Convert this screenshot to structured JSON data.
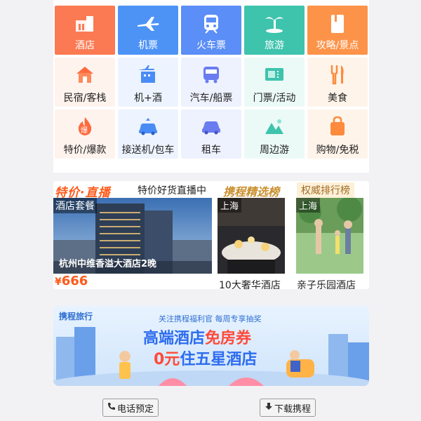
{
  "grid": {
    "row1": [
      {
        "label": "酒店",
        "icon": "hotel-building-icon"
      },
      {
        "label": "机票",
        "icon": "airplane-icon"
      },
      {
        "label": "火车票",
        "icon": "train-icon"
      },
      {
        "label": "旅游",
        "icon": "palm-tree-icon"
      },
      {
        "label": "攻略/景点",
        "icon": "guidebook-icon"
      }
    ],
    "row2": [
      {
        "label": "民宿/客栈",
        "icon": "house-icon"
      },
      {
        "label": "机+酒",
        "icon": "plane-hotel-icon"
      },
      {
        "label": "汽车/船票",
        "icon": "bus-icon"
      },
      {
        "label": "门票/活动",
        "icon": "ticket-icon"
      },
      {
        "label": "美食",
        "icon": "fork-knife-icon"
      }
    ],
    "row3": [
      {
        "label": "特价/爆款",
        "icon": "hot-deal-icon"
      },
      {
        "label": "接送机/包车",
        "icon": "car-pickup-icon"
      },
      {
        "label": "租车",
        "icon": "car-rental-icon"
      },
      {
        "label": "周边游",
        "icon": "mountain-icon"
      },
      {
        "label": "购物/免税",
        "icon": "shopping-bag-icon"
      }
    ]
  },
  "live": {
    "title": "特价·直播",
    "subtitle": "特价好货直播中",
    "tag": "酒店套餐",
    "caption": "杭州中维香溢大酒店2晚",
    "currency": "¥",
    "price": "666"
  },
  "ranking": {
    "title": "携程精选榜",
    "tag": "上海",
    "caption": "10大奢华酒店"
  },
  "authority": {
    "title": "权威排行榜",
    "tag": "上海",
    "caption": "亲子乐园酒店"
  },
  "banner": {
    "logo": "携程旅行",
    "subtitle": "关注携程福利官 每周专享抽奖",
    "line1_a": "高端酒店",
    "line1_b": "免房券",
    "line2_a": "0元",
    "line2_b": "住五星酒店"
  },
  "buttons": {
    "phone": "电话预定",
    "download": "下载携程"
  },
  "colors": {
    "hotel": "#fb7a53",
    "flight": "#4d93f6",
    "train": "#5b8ef6",
    "travel": "#3ec3ad",
    "guide": "#fd9349",
    "accent": "#ff5a1a"
  }
}
